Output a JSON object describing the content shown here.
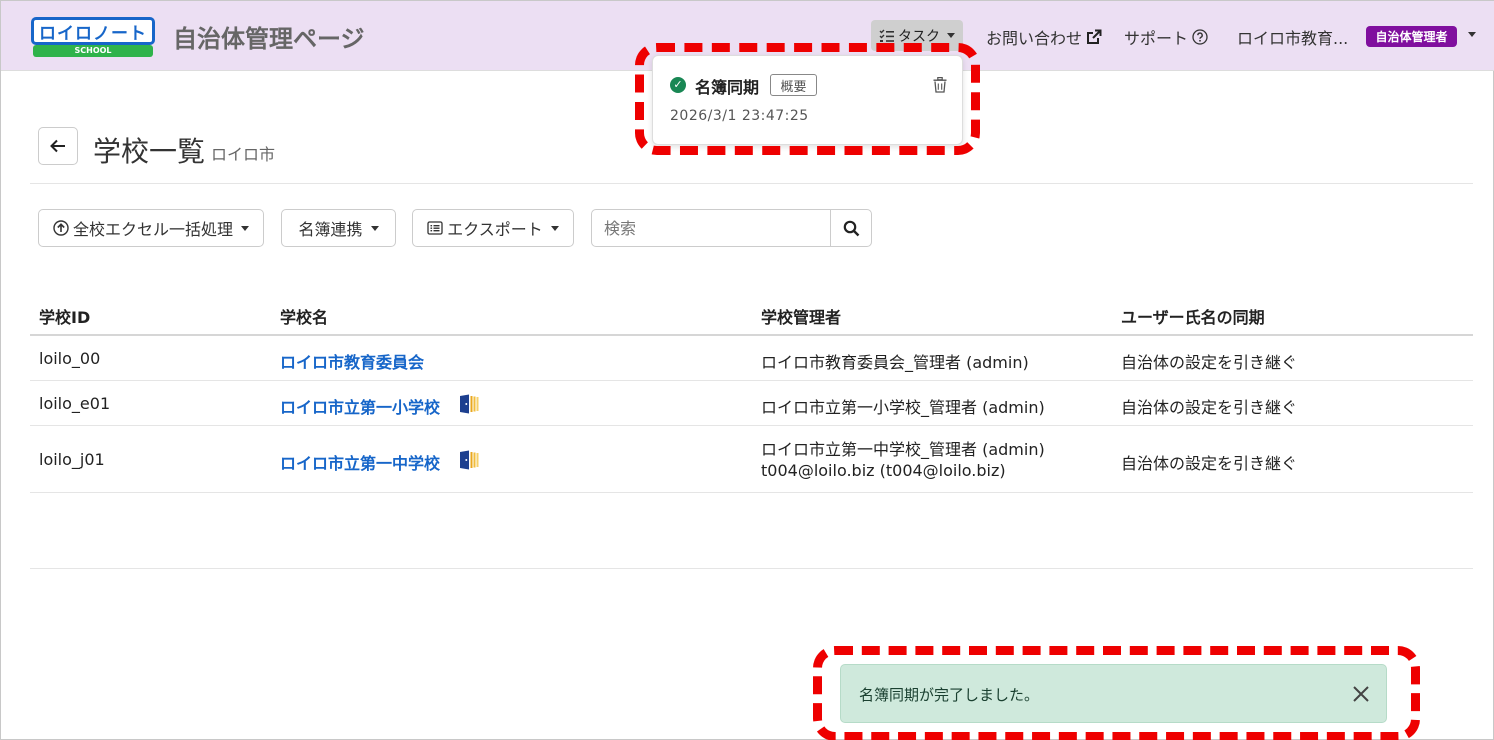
{
  "header": {
    "logo_text": "ロイロノート",
    "logo_sub": "SCHOOL",
    "app_title": "自治体管理ページ",
    "task_label": "タスク",
    "contact_label": "お問い合わせ",
    "support_label": "サポート",
    "user_name": "ロイロ市教育...",
    "role_badge": "自治体管理者",
    "background_color": "#ecdff3",
    "role_badge_color": "#800f9e"
  },
  "task_popup": {
    "title": "名簿同期",
    "badge": "概要",
    "timestamp": "2026/3/1 23:47:25",
    "status": "completed"
  },
  "page": {
    "title": "学校一覧",
    "subtitle": "ロイロ市"
  },
  "toolbar": {
    "bulk_label": "全校エクセル一括処理",
    "roster_label": "名簿連携",
    "export_label": "エクスポート",
    "search_placeholder": "検索"
  },
  "table": {
    "headers": [
      "学校ID",
      "学校名",
      "学校管理者",
      "ユーザー氏名の同期"
    ],
    "rows": [
      {
        "id": "loilo_00",
        "name": "ロイロ市教育委員会",
        "admin": "ロイロ市教育委員会_管理者 (admin)",
        "admin2": "",
        "sync": "自治体の設定を引き継ぐ",
        "has_icon": false
      },
      {
        "id": "loilo_e01",
        "name": "ロイロ市立第一小学校",
        "admin": "ロイロ市立第一小学校_管理者 (admin)",
        "admin2": "",
        "sync": "自治体の設定を引き継ぐ",
        "has_icon": true
      },
      {
        "id": "loilo_j01",
        "name": "ロイロ市立第一中学校",
        "admin": "ロイロ市立第一中学校_管理者 (admin)",
        "admin2": "t004@loilo.biz (t004@loilo.biz)",
        "sync": "自治体の設定を引き継ぐ",
        "has_icon": true
      }
    ],
    "link_color": "#1766c9"
  },
  "toast": {
    "message": "名簿同期が完了しました。",
    "background_color": "#cfe9dc"
  },
  "annotations": {
    "highlight_color": "#ee0000"
  }
}
